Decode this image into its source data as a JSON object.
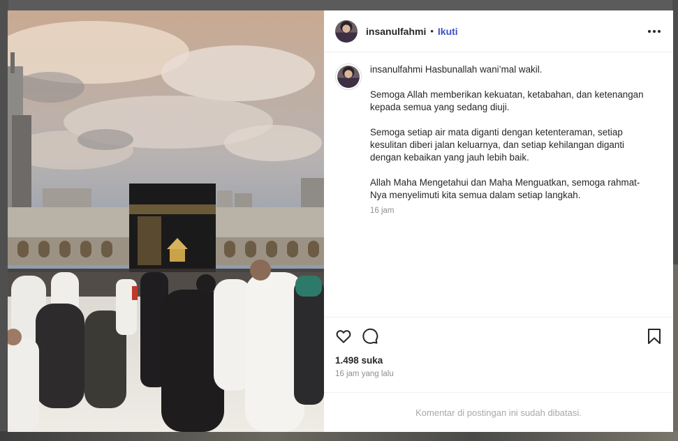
{
  "post": {
    "username": "insanulfahmi",
    "separator": "•",
    "follow_label": "Ikuti",
    "more_options": "more-horizontal-icon",
    "caption": {
      "username": "insanulfahmi",
      "first_line": "Hasbunallah wani’mal wakil.",
      "paragraph_2": "Semoga Allah memberikan kekuatan, ketabahan, dan ketenangan kepada semua yang sedang diuji.",
      "paragraph_3": "Semoga setiap air mata diganti dengan ketenteraman, setiap kesulitan diberi jalan keluarnya, dan setiap kehilangan diganti dengan kebaikan yang jauh lebih baik.",
      "paragraph_4": "Allah Maha Mengetahui dan Maha Menguatkan, semoga rahmat-Nya menyelimuti kita semua dalam setiap langkah.",
      "time": "16 jam"
    },
    "actions": {
      "like_icon": "heart-icon",
      "comment_icon": "comment-icon",
      "save_icon": "bookmark-icon"
    },
    "likes": "1.498 suka",
    "posted": "16 jam yang lalu",
    "comments_notice": "Komentar di postingan ini sudah dibatasi."
  }
}
